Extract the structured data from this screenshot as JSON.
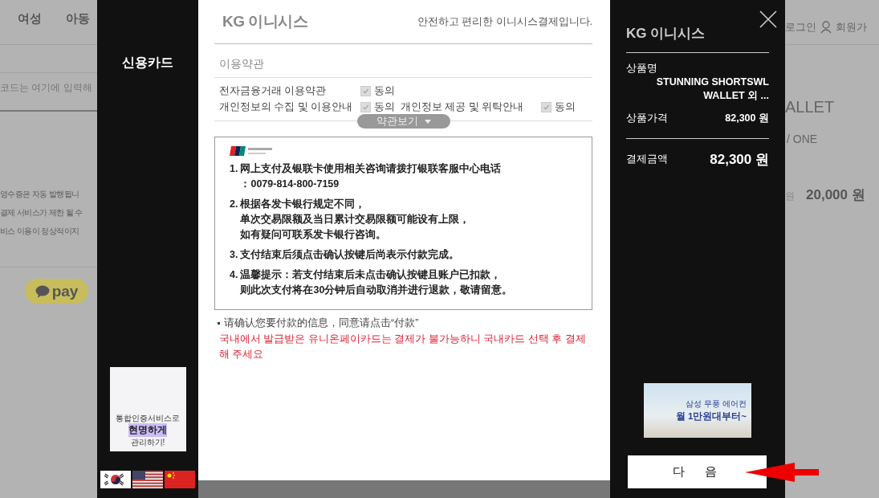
{
  "background_page": {
    "nav": [
      "여성",
      "아동"
    ],
    "coupon_hint": "코드는 여기에 입력해",
    "notices": [
      "영수증은 자동 발행됩니",
      "결제 서비스가 제한 될 수",
      "비스 이용이 정상적이지"
    ],
    "pay_button": "pay",
    "header_links": [
      "로그인",
      "회원가"
    ],
    "product_name": "ALLET",
    "product_option": "/ ONE",
    "price_unit": "원",
    "price": "20,000 원"
  },
  "modal": {
    "left": {
      "method": "신용카드",
      "banner": [
        "통합인증서비스로",
        "현명하게",
        "관리하기!"
      ]
    },
    "center": {
      "logo": "KG 이니시스",
      "tagline": "안전하고 편리한 이니시스결제입니다.",
      "terms_title": "이용약관",
      "agreements": [
        {
          "label": "전자금융거래 이용약관",
          "agree": "동의",
          "checked": true
        },
        {
          "label": "개인정보의 수집 및 이용안내",
          "agree": "동의",
          "checked": true
        },
        {
          "label": "개인정보 제공 및 위탁안내",
          "agree": "동의",
          "checked": true
        }
      ],
      "view_terms": "약관보기",
      "notice_items": [
        {
          "number": "1.",
          "lines": [
            "网上支付及银联卡使用相关咨询请拨打银联客服中心电话",
            "：0079-814-800-7159"
          ]
        },
        {
          "number": "2.",
          "lines": [
            "根据各发卡银行规定不同，",
            "单次交易限额及当日累计交易限额可能设有上限，",
            "如有疑问可联系发卡银行咨询。"
          ]
        },
        {
          "number": "3.",
          "lines": [
            "支付结束后须点击确认按键后尚表示付款完成。"
          ]
        },
        {
          "number": "4.",
          "lines": [
            "温馨提示：若支付结束后未点击确认按键且账户已扣款，",
            "则此次支付将在30分钟后自动取消并进行退款，敬请留意。"
          ]
        }
      ],
      "confirm_hint": "请确认您要付款的信息，同意请点击“付款”",
      "warning": "국내에서 발급받은 유니온페이카드는 결제가 불가능하니 국내카드 선택 후 결제해 주세요"
    },
    "right": {
      "logo": "KG 이니시스",
      "rows": [
        {
          "label": "상품명",
          "value_lines": [
            "STUNNING SHORTSWL",
            "WALLET 외 ..."
          ]
        },
        {
          "label": "상품가격",
          "value_lines": [
            "82,300 원"
          ]
        }
      ],
      "total": {
        "label": "결제금액",
        "value": "82,300 원"
      },
      "banner": [
        "삼성 무풍 에어컨",
        "월 1만원대부터~"
      ],
      "next_button": "다 음"
    }
  }
}
